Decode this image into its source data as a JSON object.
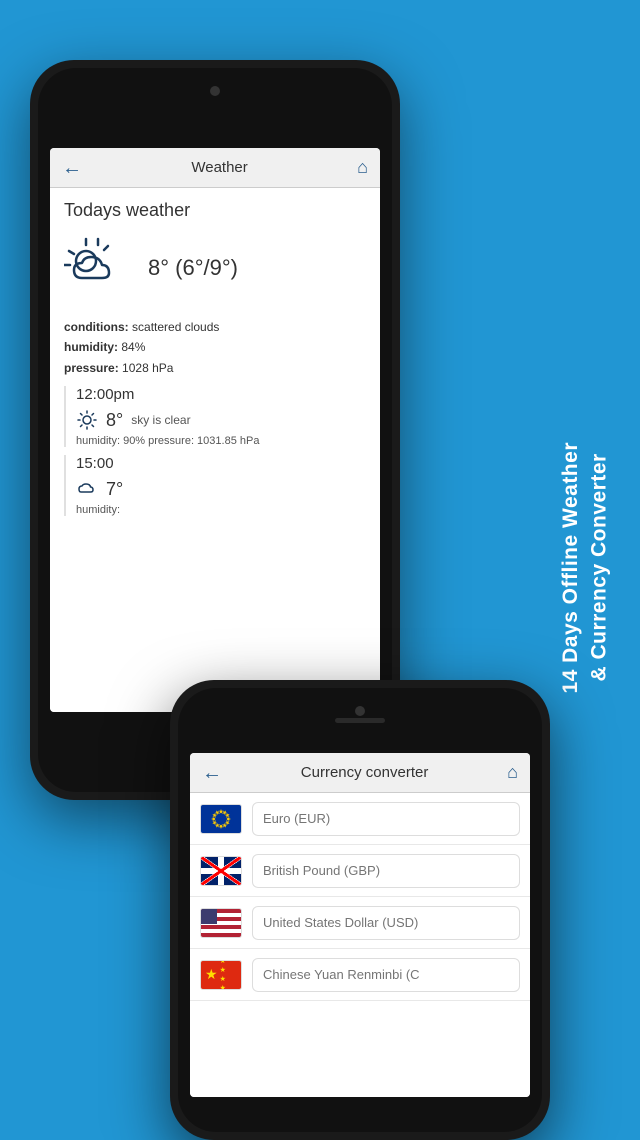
{
  "background_color": "#2196d3",
  "side_text": {
    "line1": "14 Days Offline Weather",
    "line2": "& Currency Converter"
  },
  "phone_back": {
    "nav": {
      "title": "Weather",
      "back_label": "←",
      "home_label": "⌂"
    },
    "screen": {
      "title": "Todays weather",
      "temperature": "8° (6°/9°)",
      "conditions_label": "conditions:",
      "conditions_value": "scattered clouds",
      "humidity_label": "humidity:",
      "humidity_value": "84%",
      "pressure_label": "pressure:",
      "pressure_value": "1028 hPa",
      "time_blocks": [
        {
          "time": "12:00pm",
          "temp": "8°",
          "desc": "sky is clear",
          "humidity": "humidity: 90%  pressure: 1031.85 hPa"
        },
        {
          "time": "15:00",
          "temp": "7°",
          "humidity": "humidity:"
        }
      ]
    }
  },
  "phone_front": {
    "nav": {
      "title": "Currency converter",
      "back_label": "←",
      "home_label": "⌂"
    },
    "currencies": [
      {
        "flag": "eu",
        "placeholder": "Euro (EUR)"
      },
      {
        "flag": "uk",
        "placeholder": "British Pound (GBP)"
      },
      {
        "flag": "us",
        "placeholder": "United States Dollar (USD)"
      },
      {
        "flag": "cn",
        "placeholder": "Chinese Yuan Renminbi (C"
      }
    ]
  }
}
